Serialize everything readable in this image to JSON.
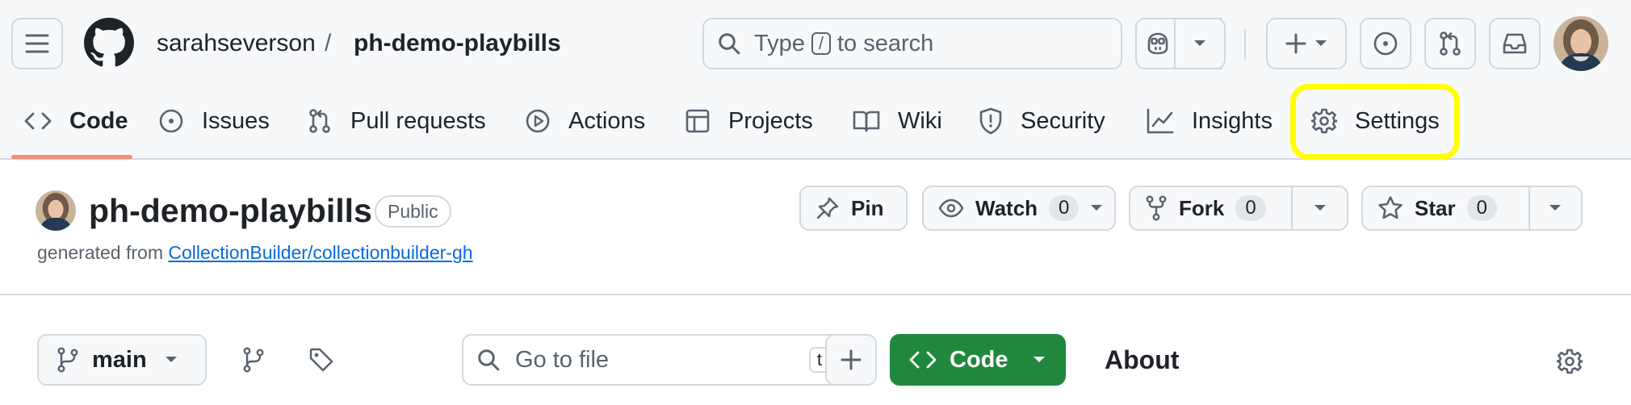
{
  "header": {
    "owner": "sarahseverson",
    "separator": "/",
    "repo": "ph-demo-playbills",
    "search": {
      "prefix": "Type",
      "key": "/",
      "suffix": "to search"
    }
  },
  "nav": {
    "tabs": [
      {
        "label": "Code",
        "icon": "code-icon",
        "selected": true
      },
      {
        "label": "Issues",
        "icon": "issue-icon"
      },
      {
        "label": "Pull requests",
        "icon": "pull-request-icon"
      },
      {
        "label": "Actions",
        "icon": "play-icon"
      },
      {
        "label": "Projects",
        "icon": "table-icon"
      },
      {
        "label": "Wiki",
        "icon": "book-icon"
      },
      {
        "label": "Security",
        "icon": "shield-icon"
      },
      {
        "label": "Insights",
        "icon": "graph-icon"
      },
      {
        "label": "Settings",
        "icon": "gear-icon",
        "highlighted": true
      }
    ],
    "highlight_color": "#ffff00",
    "selected_underline_color": "#fd8c73"
  },
  "repo": {
    "name": "ph-demo-playbills",
    "visibility": "Public",
    "generated_prefix": "generated from",
    "template_link": "CollectionBuilder/collectionbuilder-gh",
    "pin_label": "Pin",
    "watch_label": "Watch",
    "watch_count": "0",
    "fork_label": "Fork",
    "fork_count": "0",
    "star_label": "Star",
    "star_count": "0"
  },
  "file_nav": {
    "branch": "main",
    "go_to_file_placeholder": "Go to file",
    "go_to_file_key": "t",
    "code_button": "Code",
    "about_title": "About"
  },
  "colors": {
    "header_bg": "#f6f8fa",
    "border": "#d1d9e0",
    "primary_green": "#1f883d",
    "link": "#0969da"
  }
}
